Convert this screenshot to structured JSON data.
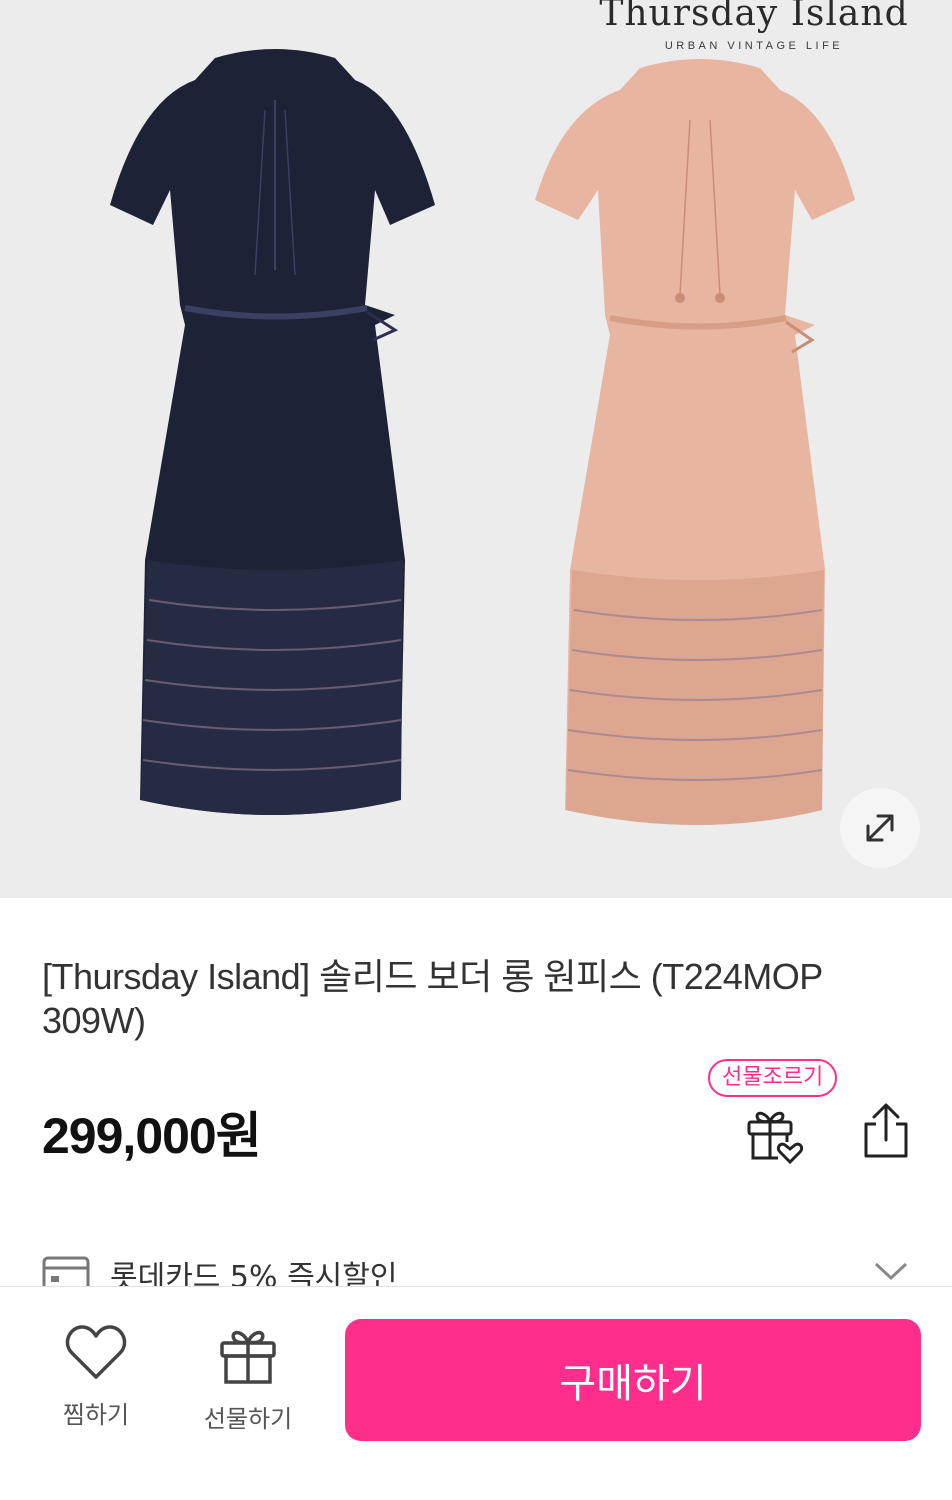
{
  "brand": {
    "name": "Thursday Island",
    "tagline": "URBAN VINTAGE LIFE"
  },
  "product": {
    "title": "[Thursday Island] 솔리드 보더 롱 원피스 (T224MOP 309W)",
    "price": "299,000원",
    "colors": [
      "#1d2236",
      "#e8b5a0"
    ]
  },
  "actions": {
    "gift_badge": "선물조르기",
    "gift_icon": "gift-heart-icon",
    "share_icon": "share-icon",
    "zoom_icon": "expand-icon"
  },
  "promo": {
    "card_text": "롯데카드 5% 즉시할인"
  },
  "bottom_bar": {
    "wish_label": "찜하기",
    "gift_label": "선물하기",
    "buy_label": "구매하기"
  },
  "colors": {
    "accent": "#ff2d8c"
  }
}
